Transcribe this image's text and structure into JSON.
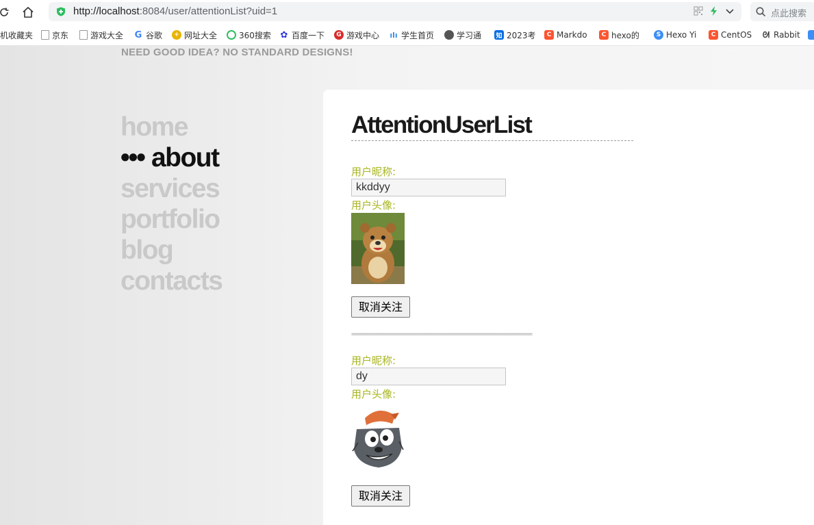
{
  "browser": {
    "url_host": "http://localhost",
    "url_rest": ":8084/user/attentionList?uid=1",
    "search_placeholder": "点此搜索",
    "bookmarks": [
      {
        "label": "机收藏夹",
        "icon": "none"
      },
      {
        "label": "京东",
        "icon": "page-icon"
      },
      {
        "label": "游戏大全",
        "icon": "page-icon"
      },
      {
        "label": "谷歌",
        "icon": "google-icon"
      },
      {
        "label": "网址大全",
        "icon": "plus-circle-icon"
      },
      {
        "label": "360搜索",
        "icon": "360-icon"
      },
      {
        "label": "百度一下",
        "icon": "baidu-paw-icon"
      },
      {
        "label": "游戏中心",
        "icon": "game-center-icon"
      },
      {
        "label": "学生首页",
        "icon": "bars-icon"
      },
      {
        "label": "学习通",
        "icon": "globe-icon"
      },
      {
        "label": "2023考",
        "icon": "zhihu-icon"
      },
      {
        "label": "Markdo",
        "icon": "csdn-icon"
      },
      {
        "label": "hexo的",
        "icon": "csdn-icon"
      },
      {
        "label": "Hexo Yi",
        "icon": "s-icon"
      },
      {
        "label": "CentOS",
        "icon": "csdn-icon"
      },
      {
        "label": "Rabbit",
        "icon": "rabbit-icon"
      }
    ]
  },
  "site": {
    "tagline": "NEED GOOD IDEA? NO STANDARD DESIGNS!",
    "nav": [
      {
        "label": "home",
        "active": false
      },
      {
        "label": "about",
        "active": true,
        "prefix": "•••"
      },
      {
        "label": "services",
        "active": false
      },
      {
        "label": "portfolio",
        "active": false
      },
      {
        "label": "blog",
        "active": false
      },
      {
        "label": "contacts",
        "active": false
      }
    ]
  },
  "main": {
    "title": "AttentionUserList",
    "separator": "=====================================================================",
    "users": [
      {
        "nickname_label": "用户昵称:",
        "nickname": "kkddyy",
        "avatar_label": "用户头像:",
        "avatar": "bear-avatar",
        "unfollow_label": "取消关注"
      },
      {
        "nickname_label": "用户昵称:",
        "nickname": "dy",
        "avatar_label": "用户头像:",
        "avatar": "wolf-avatar",
        "unfollow_label": "取消关注"
      }
    ]
  },
  "colors": {
    "label_green": "#a8b51e",
    "nav_inactive": "#c9c9c9",
    "nav_active": "#111111"
  }
}
